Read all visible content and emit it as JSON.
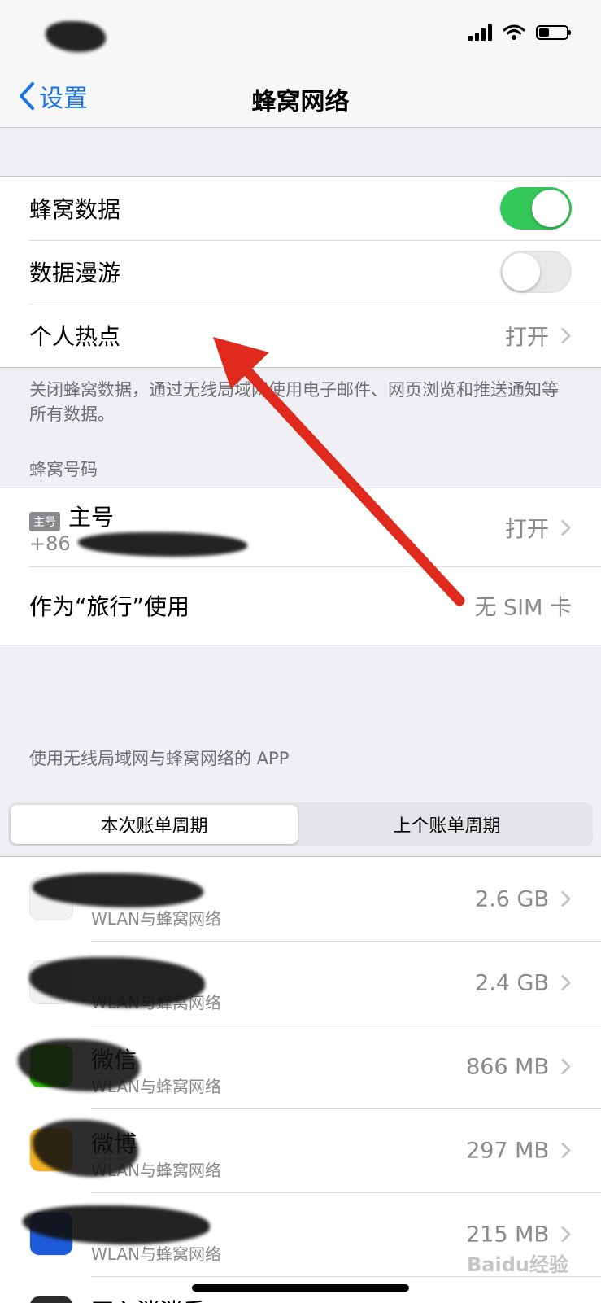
{
  "navbar": {
    "back_label": "设置",
    "title": "蜂窝网络"
  },
  "settings": {
    "cellular_data": {
      "label": "蜂窝数据",
      "on": true
    },
    "data_roaming": {
      "label": "数据漫游",
      "on": false
    },
    "hotspot": {
      "label": "个人热点",
      "value": "打开"
    }
  },
  "footnote": "关闭蜂窝数据，通过无线局域网使用电子邮件、网页浏览和推送通知等所有数据。",
  "cellular_numbers": {
    "header": "蜂窝号码",
    "primary": {
      "badge": "主号",
      "label": "主号",
      "number_prefix": "+86",
      "value": "打开"
    },
    "travel": {
      "label": "作为“旅行”使用",
      "value": "无 SIM 卡"
    }
  },
  "apps_section": {
    "header": "使用无线局域网与蜂窝网络的 APP",
    "segments": [
      "本次账单周期",
      "上个账单周期"
    ],
    "selected_segment": 0,
    "apps": [
      {
        "name": "",
        "sub": "WLAN与蜂窝网络",
        "usage": "2.6 GB"
      },
      {
        "name": "",
        "sub": "WLAN与蜂窝网络",
        "usage": "2.4 GB"
      },
      {
        "name": "微信",
        "sub": "WLAN与蜂窝网络",
        "usage": "866 MB"
      },
      {
        "name": "微博",
        "sub": "WLAN与蜂窝网络",
        "usage": "297 MB"
      },
      {
        "name": "",
        "sub": "WLAN与蜂窝网络",
        "usage": "215 MB"
      },
      {
        "name": "开心消消乐®",
        "sub": "",
        "usage": ""
      }
    ]
  },
  "watermark": "Baidu经验",
  "colors": {
    "accent": "#1a73e8",
    "toggle_on": "#34c759",
    "annotation_arrow": "#e02a1d"
  }
}
